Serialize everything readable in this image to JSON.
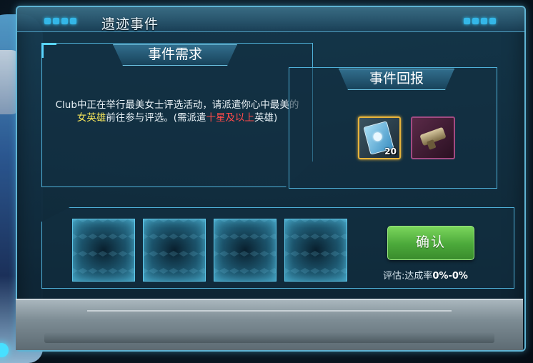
{
  "window": {
    "title": "遗迹事件"
  },
  "requirement": {
    "title": "事件需求",
    "text_part1": "Club中正在举行最美女士评选活动，请派遣你心中最美的",
    "highlight_yellow": "女英雄",
    "text_part2": "前往参与评选。(需派遣",
    "highlight_red": "十星及以上",
    "text_part3": "英雄)"
  },
  "reward": {
    "title": "事件回报",
    "items": [
      {
        "icon": "hero-card-icon",
        "count": "20",
        "border_color": "#e8b43b"
      },
      {
        "icon": "weapon-icon",
        "count": "",
        "border_color": "#a24a82"
      }
    ]
  },
  "slots": {
    "count": 4
  },
  "actions": {
    "confirm_label": "确认",
    "eval_label": "评估:达成率",
    "eval_value": "0%-0%"
  },
  "colors": {
    "accent": "#4fb0d8",
    "confirm_green": "#4ba83a",
    "highlight_yellow": "#f3e35a",
    "highlight_red": "#ff4a4a"
  }
}
